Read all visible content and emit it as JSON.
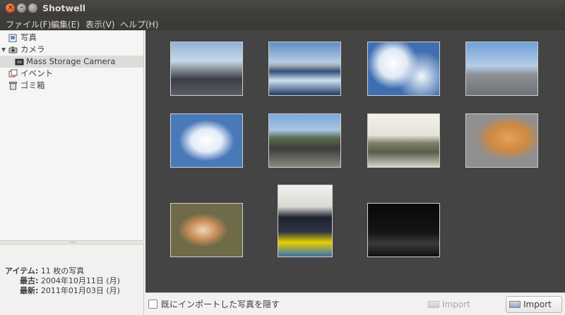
{
  "window": {
    "title": "Shotwell"
  },
  "menubar": {
    "items": [
      "ファイル(F)",
      "編集(E)",
      "表示(V)",
      "ヘルプ(H)"
    ]
  },
  "sidebar": {
    "items": [
      {
        "label": "写真",
        "icon": "photos-icon"
      },
      {
        "label": "カメラ",
        "icon": "camera-icon"
      },
      {
        "label": "Mass Storage Camera",
        "icon": "camera-device-icon"
      },
      {
        "label": "イベント",
        "icon": "events-icon"
      },
      {
        "label": "ゴミ箱",
        "icon": "trash-icon"
      }
    ]
  },
  "info": {
    "items_key": "アイテム:",
    "items_value": "11 枚の写真",
    "oldest_key": "最古:",
    "oldest_value": "2004年10月11日 (月)",
    "newest_key": "最新:",
    "newest_value": "2011年01月03日 (月)"
  },
  "bottombar": {
    "hide_imported_label": "既にインポートした写真を隠す",
    "import_selected_label": "Import Selected",
    "import_all_label": "Import All"
  },
  "colors": {
    "viewer_bg": "#444444",
    "titlebar_bg": "#3c3b37",
    "close_button": "#e2561b"
  }
}
